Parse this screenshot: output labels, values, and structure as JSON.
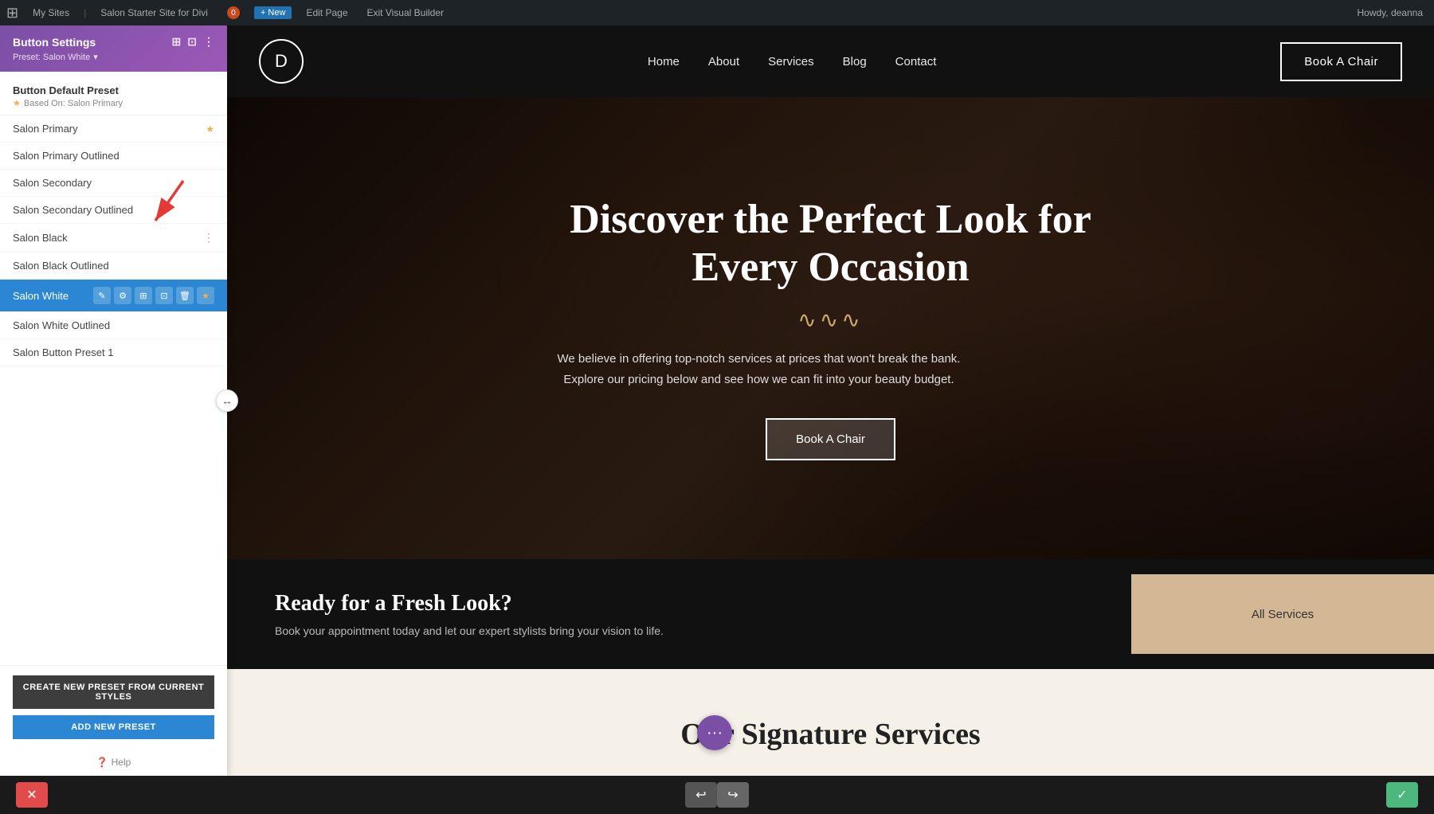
{
  "admin_bar": {
    "wp_logo": "⊞",
    "my_sites": "My Sites",
    "site_name": "Salon Starter Site for Divi",
    "comments_count": "0",
    "new_label": "+ New",
    "edit_page": "Edit Page",
    "exit_builder": "Exit Visual Builder",
    "howdy": "Howdy, deanna"
  },
  "panel": {
    "title": "Button Settings",
    "preset_label": "Preset: Salon White",
    "preset_dropdown_icon": "▾",
    "header_icons": [
      "⊞",
      "⊡",
      "⋮"
    ],
    "default_preset": {
      "name": "Button Default Preset",
      "based_on": "Based On: Salon Primary"
    },
    "presets": [
      {
        "id": "salon-primary",
        "name": "Salon Primary",
        "starred": true,
        "active": false
      },
      {
        "id": "salon-primary-outlined",
        "name": "Salon Primary Outlined",
        "starred": false,
        "active": false
      },
      {
        "id": "salon-secondary",
        "name": "Salon Secondary",
        "starred": false,
        "active": false
      },
      {
        "id": "salon-secondary-outlined",
        "name": "Salon Secondary Outlined",
        "starred": false,
        "active": false
      },
      {
        "id": "salon-black",
        "name": "Salon Black",
        "starred": false,
        "active": false
      },
      {
        "id": "salon-black-outlined",
        "name": "Salon Black Outlined",
        "starred": false,
        "active": false
      },
      {
        "id": "salon-white",
        "name": "Salon White",
        "starred": false,
        "active": true
      },
      {
        "id": "salon-white-outlined",
        "name": "Salon White Outlined",
        "starred": false,
        "active": false
      },
      {
        "id": "salon-button-preset-1",
        "name": "Salon Button Preset 1",
        "starred": false,
        "active": false
      }
    ],
    "active_preset_tools": [
      "✎",
      "⚙",
      "⊞",
      "⊡",
      "🗑",
      "★"
    ],
    "create_preset_label": "CREATE NEW PRESET FROM CURRENT STYLES",
    "add_preset_label": "ADD NEW PRESET",
    "help_label": "Help"
  },
  "site": {
    "logo_letter": "D",
    "nav_links": [
      "Home",
      "About",
      "Services",
      "Blog",
      "Contact"
    ],
    "nav_cta": "Book A Chair",
    "hero": {
      "title": "Discover the Perfect Look for Every Occasion",
      "divider": "∿∿∿",
      "subtitle": "We believe in offering top-notch services at prices that won't break the bank. Explore our pricing below and see how we can fit into your beauty budget.",
      "cta": "Book A Chair"
    },
    "cta_section": {
      "title": "Ready for a Fresh Look?",
      "subtitle": "Book your appointment today and let our expert stylists bring your vision to life.",
      "all_services": "All Services"
    },
    "services_section": {
      "title": "Our Signature Services"
    }
  },
  "bottom_bar": {
    "close_icon": "✕",
    "undo_icon": "↩",
    "redo_icon": "↪",
    "confirm_icon": "✓"
  },
  "floating_btn": {
    "icon": "•••"
  }
}
